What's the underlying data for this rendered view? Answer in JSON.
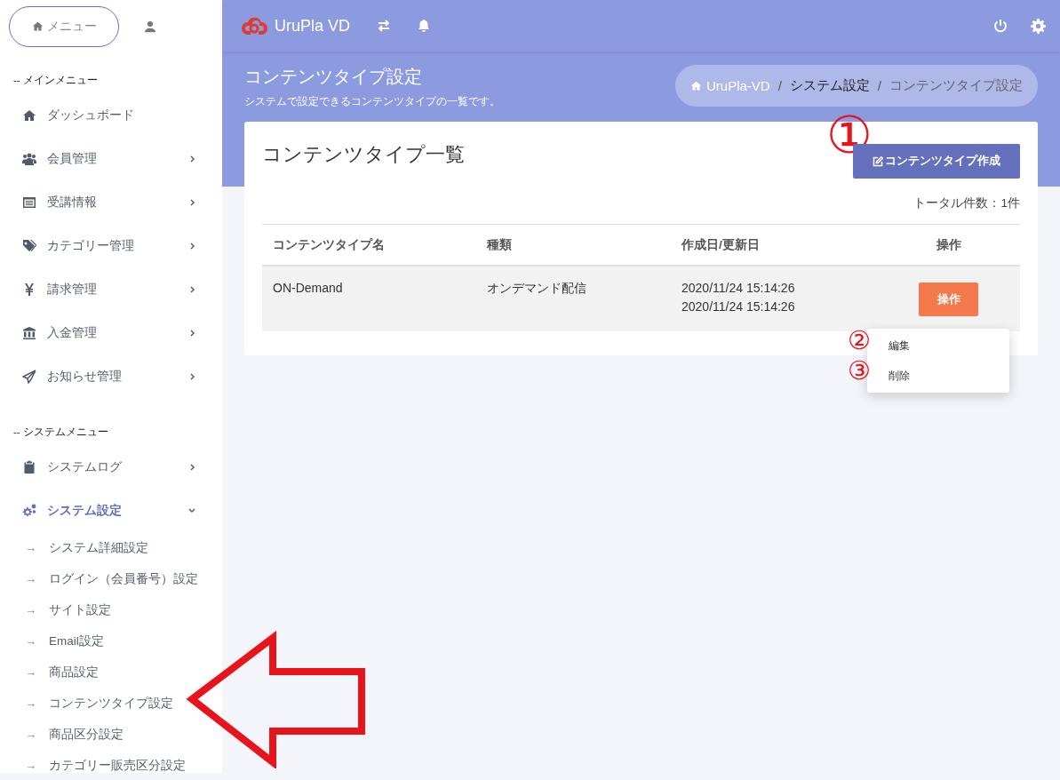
{
  "sidebar": {
    "menu_button": "メニュー",
    "sections": [
      {
        "heading": "-- メインメニュー",
        "items": [
          {
            "label": "ダッシュボード",
            "kind": "home",
            "selected": false
          },
          {
            "label": "会員管理",
            "kind": "users",
            "expanded": false,
            "selected": false
          },
          {
            "label": "受講情報",
            "kind": "list",
            "expanded": false,
            "selected": false
          },
          {
            "label": "カテゴリー管理",
            "kind": "tag",
            "expanded": false,
            "selected": false
          },
          {
            "label": "請求管理",
            "kind": "yen",
            "expanded": false,
            "selected": false
          },
          {
            "label": "入金管理",
            "kind": "bank",
            "expanded": false,
            "selected": false
          },
          {
            "label": "お知らせ管理",
            "kind": "send",
            "expanded": false,
            "selected": false
          }
        ]
      },
      {
        "heading": "-- システムメニュー",
        "items": [
          {
            "label": "システムログ",
            "kind": "clipboard",
            "expanded": false,
            "selected": false
          },
          {
            "label": "システム設定",
            "kind": "cogs",
            "expanded": true,
            "selected": true,
            "children": [
              {
                "arrow": "→",
                "label": "システム詳細設定"
              },
              {
                "arrow": "→",
                "label": "ログイン（会員番号）設定"
              },
              {
                "arrow": "→",
                "label": "サイト設定"
              },
              {
                "arrow": "→",
                "label": "Email設定"
              },
              {
                "arrow": "→",
                "label": "商品設定"
              },
              {
                "arrow": "→",
                "label": "コンテンツタイプ設定"
              },
              {
                "arrow": "→",
                "label": "商品区分設定"
              },
              {
                "arrow": "→",
                "label": "カテゴリー販売区分設定"
              }
            ]
          }
        ]
      }
    ]
  },
  "topbar": {
    "brand": "UruPla VD"
  },
  "page_header": {
    "title": "コンテンツタイプ設定",
    "subtitle": "システムで設定できるコンテンツタイプの一覧です。",
    "breadcrumb": [
      {
        "label": "UruPla-VD",
        "kind": "home",
        "current": false
      },
      {
        "label": "システム設定",
        "kind": "text",
        "separator_before": "/",
        "current": false
      },
      {
        "label": "コンテンツタイプ設定",
        "kind": "text",
        "separator_before": "/",
        "current": true
      }
    ]
  },
  "card": {
    "title": "コンテンツタイプ一覧",
    "create_button": {
      "label": "コンテンツタイプ作成",
      "annotation": "①"
    },
    "total": "トータル件数：1件",
    "table": {
      "columns": [
        "コンテンツタイプ名",
        "種類",
        "作成日/更新日",
        "操作"
      ],
      "rows": [
        {
          "name": "ON-Demand",
          "type": "オンデマンド配信",
          "dates": [
            "2020/11/24 15:14:26",
            "2020/11/24 15:14:26"
          ],
          "action": "操作"
        }
      ]
    },
    "action_menu": [
      {
        "label": "編集",
        "annotation": "②"
      },
      {
        "label": "削除",
        "annotation": "③"
      }
    ]
  }
}
